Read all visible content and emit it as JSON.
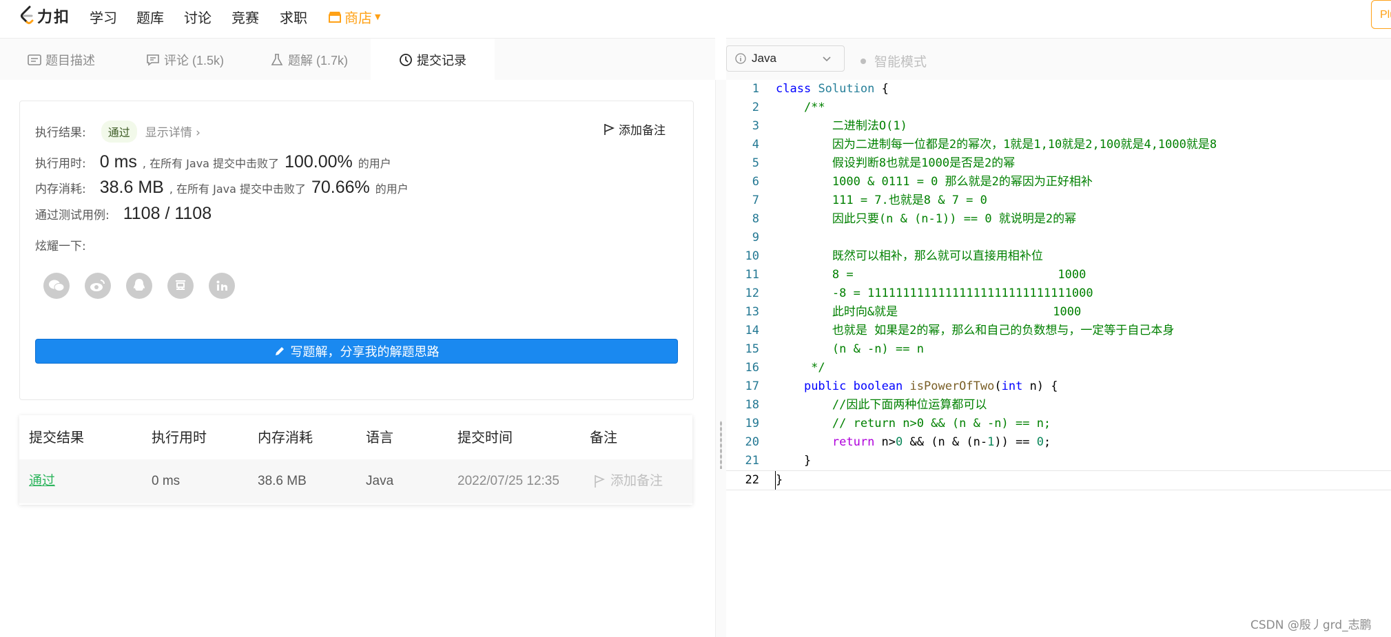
{
  "header": {
    "logo_text": "力扣",
    "nav": [
      "学习",
      "题库",
      "讨论",
      "竞赛",
      "求职"
    ],
    "store_label": "商店",
    "plus_label": "Plu"
  },
  "tabs": [
    {
      "label": "题目描述",
      "icon": "description-icon"
    },
    {
      "label": "评论 (1.5k)",
      "icon": "comment-icon"
    },
    {
      "label": "题解 (1.7k)",
      "icon": "flask-icon"
    },
    {
      "label": "提交记录",
      "icon": "clock-icon",
      "active": true
    }
  ],
  "result": {
    "exec_result_label": "执行结果:",
    "status": "通过",
    "show_detail": "显示详情 ›",
    "add_note": "添加备注",
    "time_label": "执行用时:",
    "time_value": "0 ms",
    "time_mid": ", 在所有 Java 提交中击败了",
    "time_pct": "100.00%",
    "time_tail": "的用户",
    "mem_label": "内存消耗:",
    "mem_value": "38.6 MB",
    "mem_mid": ", 在所有 Java 提交中击败了",
    "mem_pct": "70.66%",
    "mem_tail": "的用户",
    "tests_label": "通过测试用例:",
    "tests_value": "1108 / 1108",
    "share_label": "炫耀一下:",
    "share_icons": [
      "wechat-icon",
      "weibo-icon",
      "qq-icon",
      "douban-icon",
      "linkedin-icon"
    ],
    "write_solution": "写题解，分享我的解题思路"
  },
  "submissions": {
    "columns": [
      "提交结果",
      "执行用时",
      "内存消耗",
      "语言",
      "提交时间",
      "备注"
    ],
    "rows": [
      {
        "result": "通过",
        "time": "0 ms",
        "memory": "38.6 MB",
        "language": "Java",
        "submitted": "2022/07/25 12:35",
        "note": "添加备注"
      }
    ]
  },
  "editor": {
    "language": "Java",
    "mode": "智能模式",
    "line_numbers": [
      "1",
      "2",
      "3",
      "4",
      "5",
      "6",
      "7",
      "8",
      "9",
      "10",
      "11",
      "12",
      "13",
      "14",
      "15",
      "16",
      "17",
      "18",
      "19",
      "20",
      "21",
      "22"
    ]
  },
  "watermark": "CSDN @殷丿grd_志鹏",
  "colors": {
    "accent": "#ffa116",
    "success": "#2db55d",
    "primary_button": "#1a89f0"
  }
}
